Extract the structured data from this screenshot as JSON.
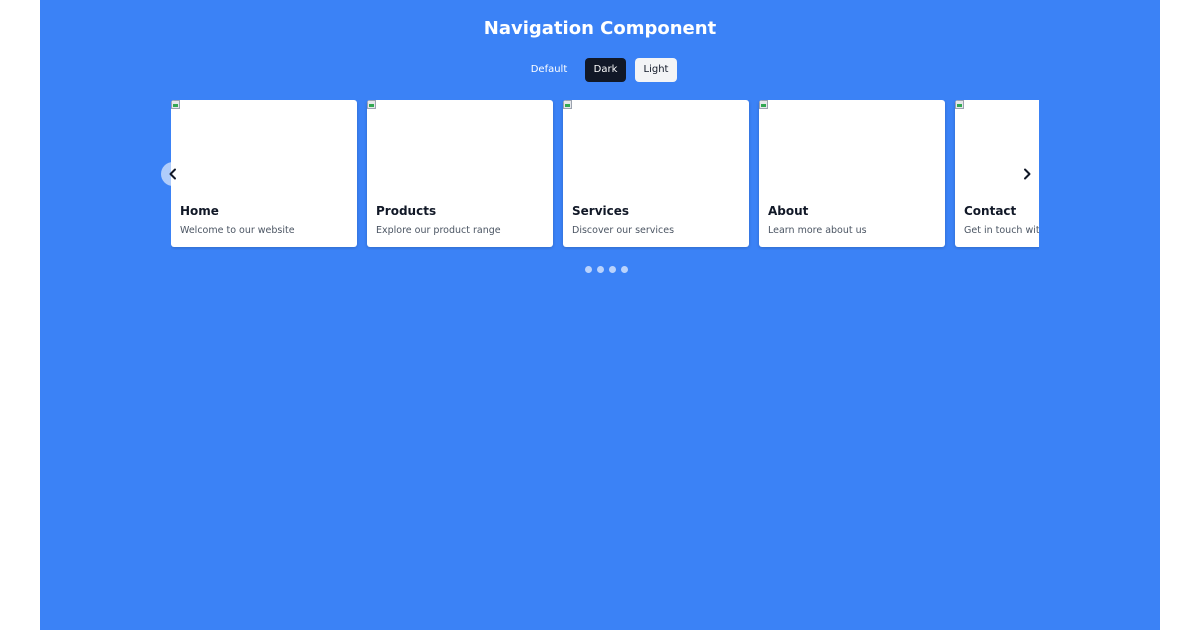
{
  "page": {
    "title": "Navigation Component",
    "background_color": "#3b82f6"
  },
  "variants": {
    "default_label": "Default",
    "dark_label": "Dark",
    "light_label": "Light",
    "selected": "Light"
  },
  "carousel": {
    "cards": [
      {
        "title": "Home",
        "description": "Welcome to our website",
        "image": "broken-image-icon"
      },
      {
        "title": "Products",
        "description": "Explore our product range",
        "image": "broken-image-icon"
      },
      {
        "title": "Services",
        "description": "Discover our services",
        "image": "broken-image-icon"
      },
      {
        "title": "About",
        "description": "Learn more about us",
        "image": "broken-image-icon"
      },
      {
        "title": "Contact",
        "description": "Get in touch with us",
        "image": "broken-image-icon"
      }
    ],
    "prev_icon": "chevron-left-icon",
    "next_icon": "chevron-right-icon",
    "dot_count": 4
  }
}
